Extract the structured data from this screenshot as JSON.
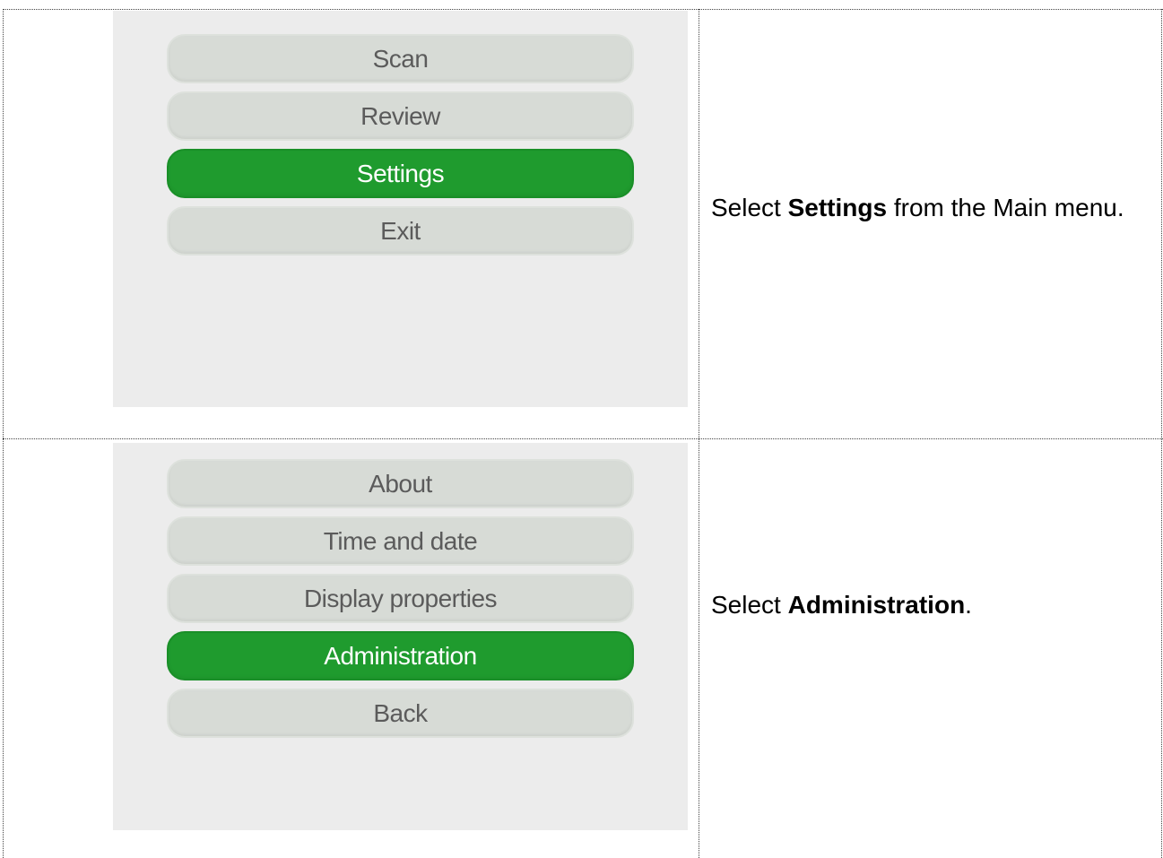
{
  "steps": [
    {
      "menu": [
        "Scan",
        "Review",
        "Settings",
        "Exit"
      ],
      "selected": "Settings",
      "instruction": {
        "prefix": "Select ",
        "bold": "Settings",
        "suffix": " from the Main menu."
      }
    },
    {
      "menu": [
        "About",
        "Time and date",
        "Display properties",
        "Administration",
        "Back"
      ],
      "selected": "Administration",
      "instruction": {
        "prefix": "Select ",
        "bold": "Administration",
        "suffix": "."
      }
    }
  ],
  "colors": {
    "selected_button": "#1f9b2e",
    "button": "#d7dbd6",
    "screen_background": "#ececec"
  }
}
